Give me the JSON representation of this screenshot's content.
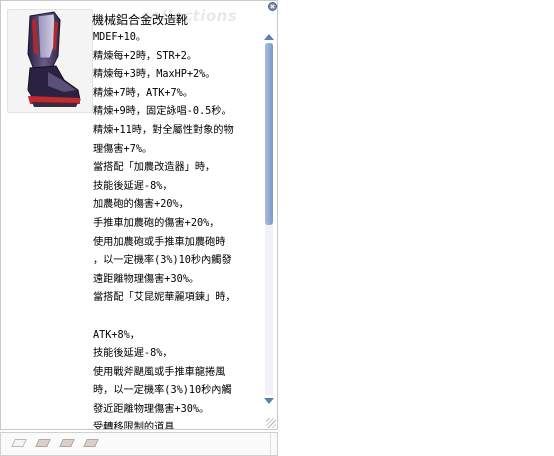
{
  "item": {
    "name": "機械鋁合金改造靴",
    "watermark": "collections",
    "image_icon": "mechanical-boots-icon"
  },
  "description": [
    "MDEF+10。",
    "精煉每+2時，STR+2。",
    "精煉每+3時，MaxHP+2%。",
    "精煉+7時，ATK+7%。",
    "精煉+9時，固定詠唱-0.5秒。",
    "精煉+11時，對全屬性對象的物",
    "理傷害+7%。",
    "當搭配「加農改造器」時，",
    "技能後延遲-8%，",
    "加農砲的傷害+20%，",
    "手推車加農砲的傷害+20%，",
    "使用加農砲或手推車加農砲時",
    "，以一定機率(3%)10秒內觸發",
    "遠距離物理傷害+30%。",
    "當搭配「艾昆妮華麗項鍊」時，",
    "",
    "ATK+8%，",
    "技能後延遲-8%，",
    "使用戰斧颶風或手推車龍捲風",
    "時，以一定機率(3%)10秒內觸",
    "發近距離物理傷害+30%。"
  ],
  "restriction_link": "受轉移限制的道具",
  "card_slots": [
    {
      "state": "empty"
    },
    {
      "state": "filled"
    },
    {
      "state": "filled"
    },
    {
      "state": "filled"
    }
  ],
  "colors": {
    "scroll_thumb": "#7d97c8",
    "close_button": "#7a8ab0"
  }
}
